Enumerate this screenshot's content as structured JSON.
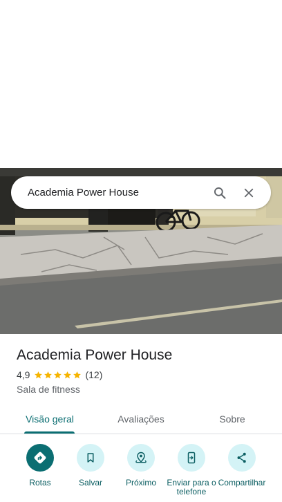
{
  "search": {
    "query": "Academia Power House"
  },
  "place": {
    "name": "Academia Power House",
    "rating": "4,9",
    "stars": 5,
    "review_count": "(12)",
    "category": "Sala de fitness"
  },
  "tabs": [
    {
      "label": "Visão geral",
      "active": true
    },
    {
      "label": "Avaliações",
      "active": false
    },
    {
      "label": "Sobre",
      "active": false
    }
  ],
  "actions": [
    {
      "label": "Rotas",
      "icon": "directions-icon"
    },
    {
      "label": "Salvar",
      "icon": "bookmark-icon"
    },
    {
      "label": "Próximo",
      "icon": "nearby-icon"
    },
    {
      "label": "Enviar para o telefone",
      "icon": "send-to-phone-icon"
    },
    {
      "label": "Compartilhar",
      "icon": "share-icon"
    }
  ],
  "colors": {
    "accent": "#0b6e72",
    "action_bg": "#d4f3f6",
    "star": "#f6b400"
  }
}
